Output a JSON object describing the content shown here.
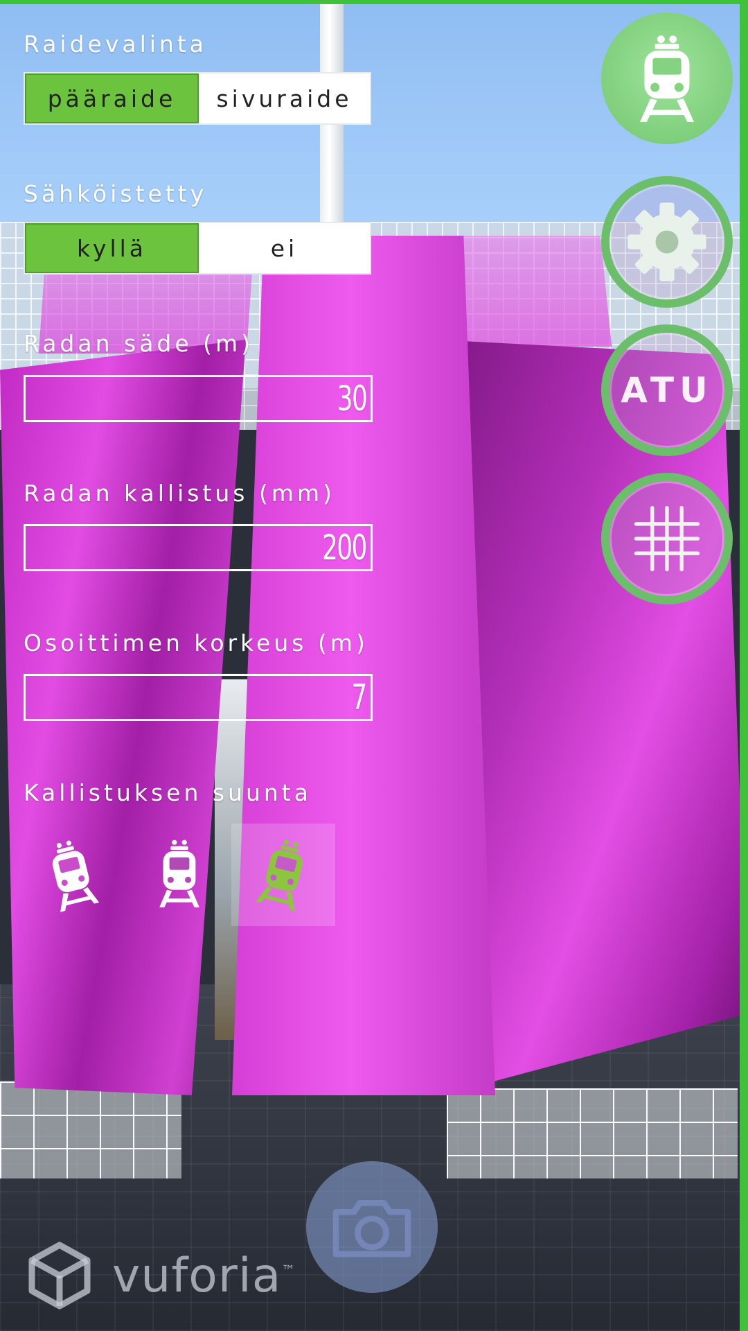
{
  "panel": {
    "track_label": "Raidevalinta",
    "track_options": [
      "pääraide",
      "sivuraide"
    ],
    "track_selected": "pääraide",
    "electrified_label": "Sähköistetty",
    "electrified_options": [
      "kyllä",
      "ei"
    ],
    "electrified_selected": "kyllä",
    "radius_label": "Radan säde (m)",
    "radius_value": "30",
    "cant_label": "Radan kallistus (mm)",
    "cant_value": "200",
    "pointer_height_label": "Osoittimen korkeus (m)",
    "pointer_height_value": "7",
    "tilt_direction_label": "Kallistuksen suunta",
    "tilt_direction_options": [
      "tilt-left",
      "level",
      "tilt-right"
    ],
    "tilt_direction_selected": "tilt-right"
  },
  "side_buttons": {
    "train_icon": "train-icon",
    "settings_icon": "gear-icon",
    "atu_label": "ATU",
    "grid_icon": "grid-icon"
  },
  "camera": {
    "icon": "camera-icon"
  },
  "branding": {
    "logo_text": "vuforia",
    "trademark": "™"
  },
  "colors": {
    "accent_green": "#6cc43e",
    "frame_green": "#3fc23a",
    "model_magenta": "#e24ce3"
  }
}
